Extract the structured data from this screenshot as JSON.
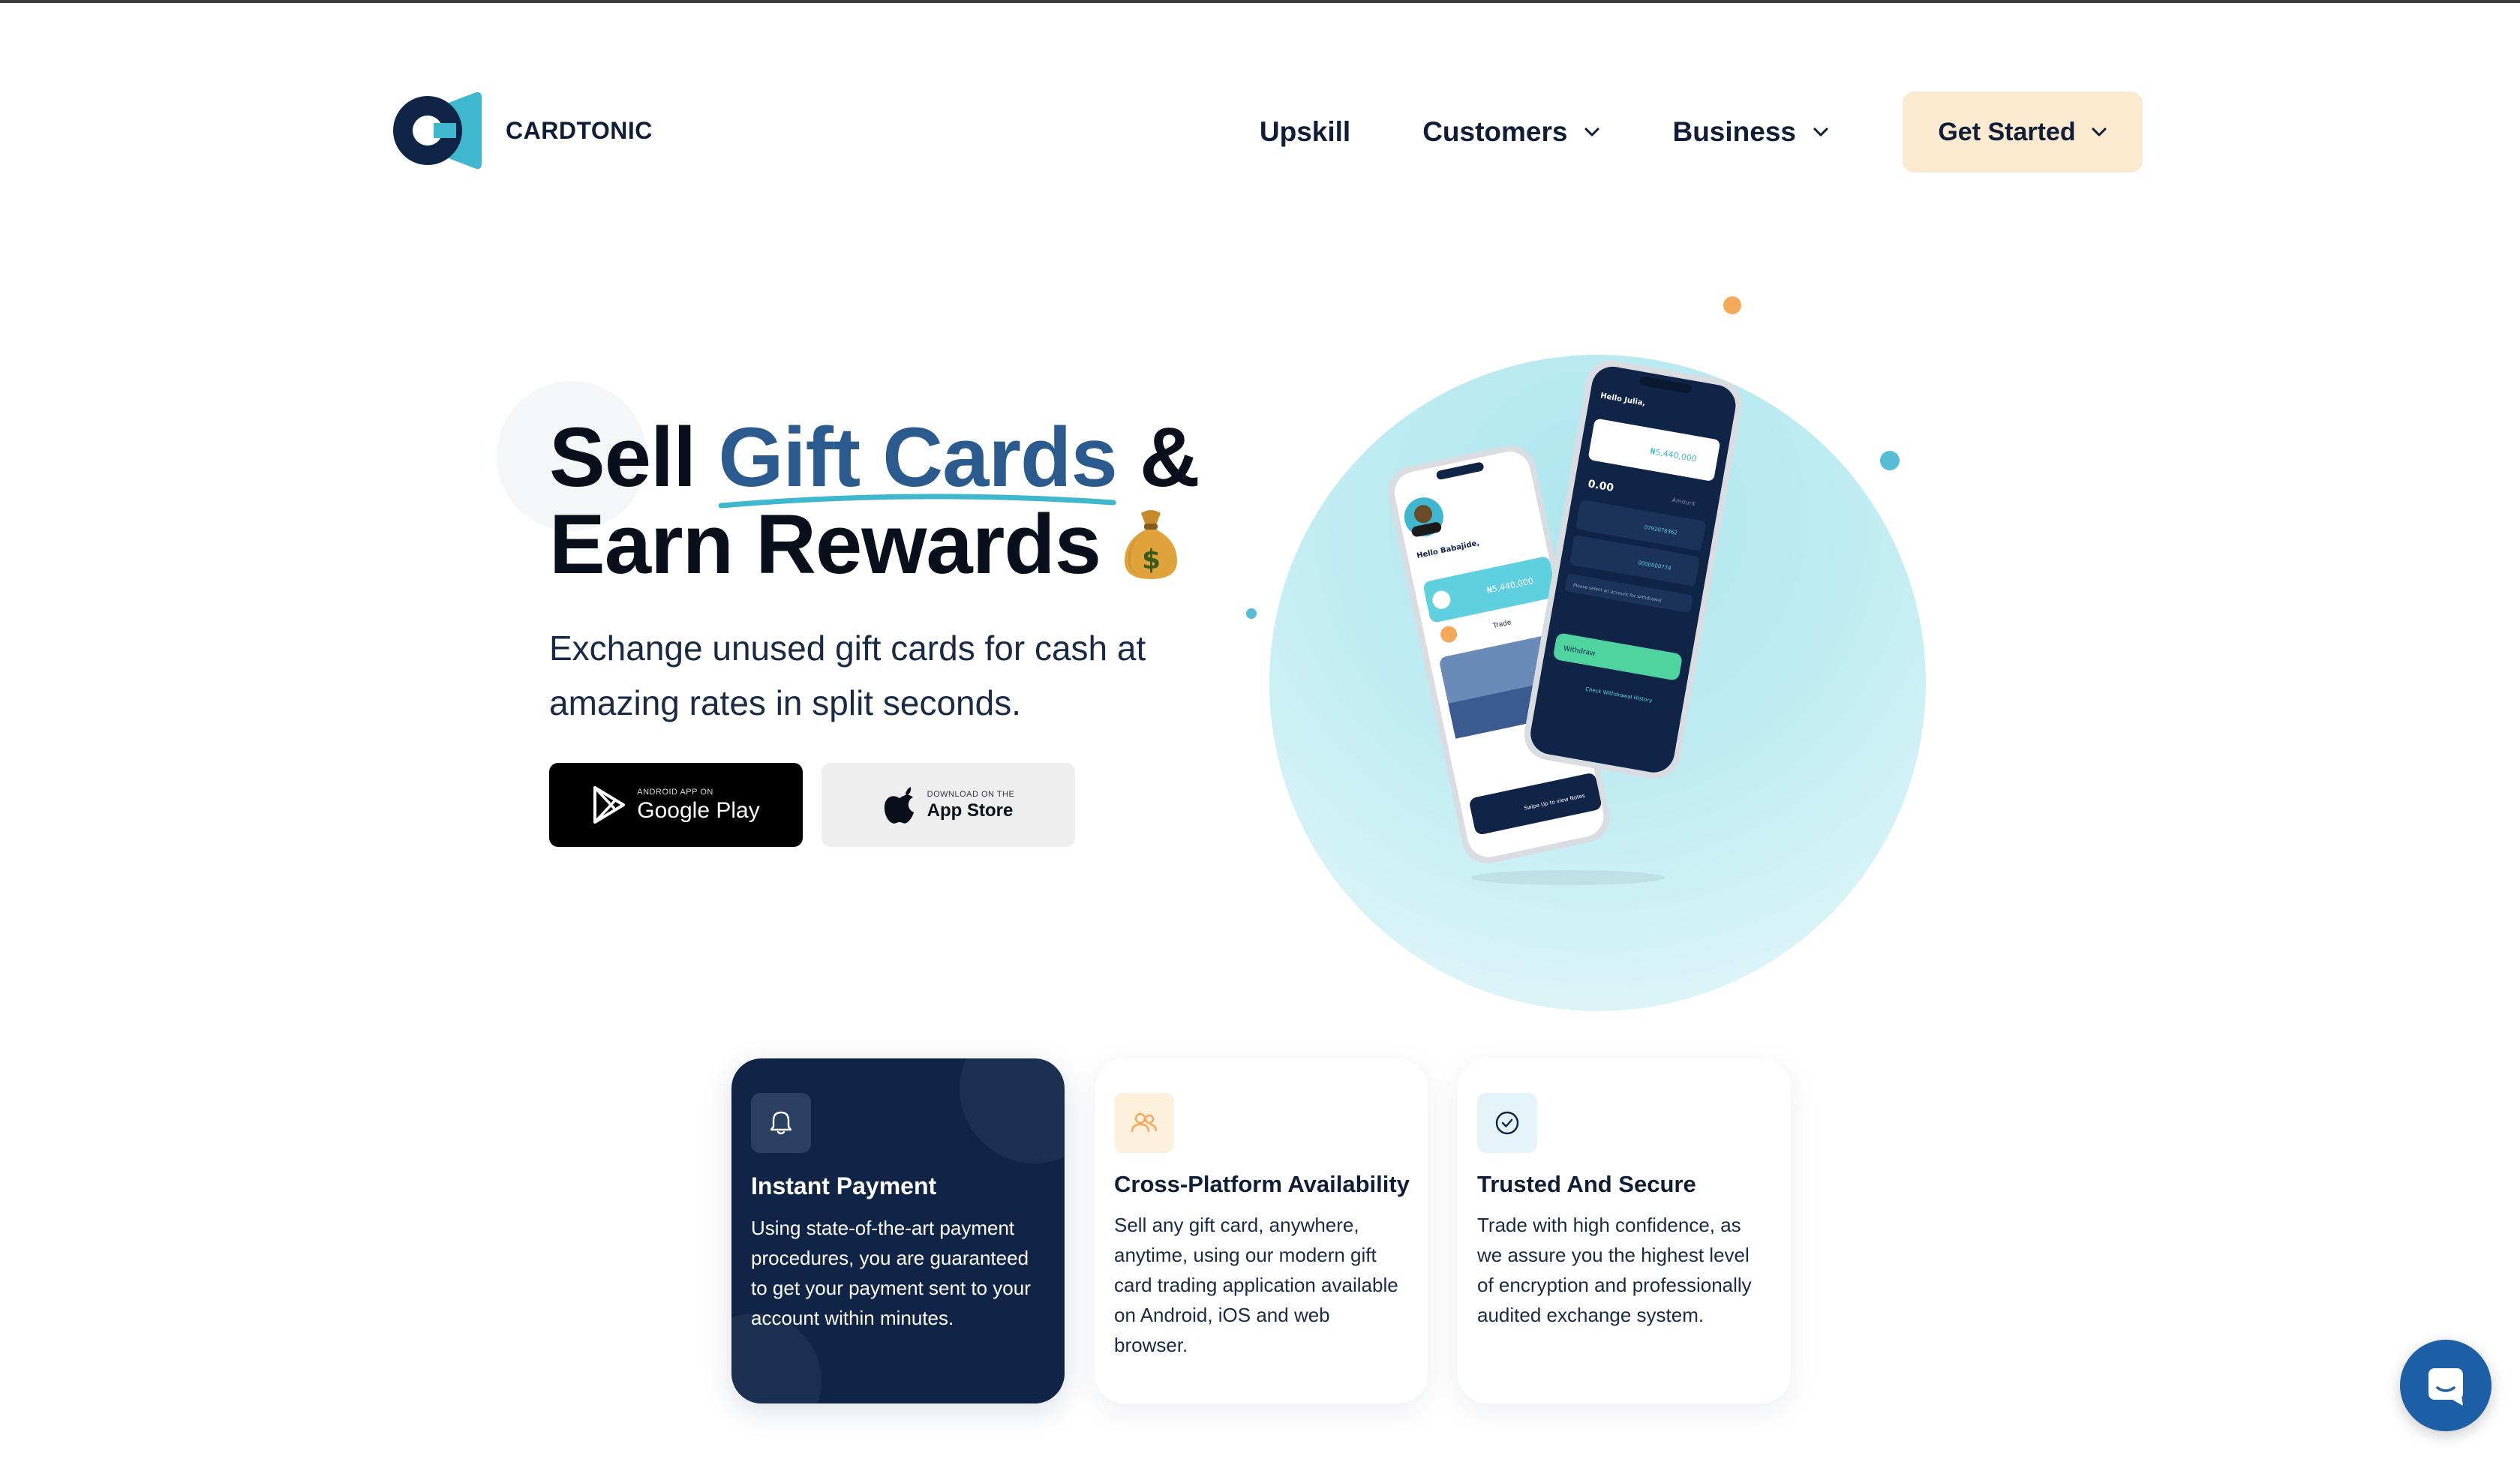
{
  "brand": {
    "name": "CARDTONIC",
    "logo_icon": "cardtonic-logo-icon",
    "colors": {
      "navy": "#0f2447",
      "teal": "#3fb8cf",
      "accent_blue": "#2b5a8f",
      "cta_bg": "#fbead0",
      "orange": "#f4a95c"
    }
  },
  "nav": {
    "items": [
      {
        "label": "Upskill",
        "has_dropdown": false
      },
      {
        "label": "Customers",
        "has_dropdown": true
      },
      {
        "label": "Business",
        "has_dropdown": true
      }
    ],
    "cta": {
      "label": "Get Started",
      "has_dropdown": true
    }
  },
  "hero": {
    "title_prefix": "Sell ",
    "title_highlight": "Gift Cards",
    "title_amp": " &",
    "title_line2": "Earn Rewards",
    "title_emoji_icon": "money-bag-icon",
    "subtitle": "Exchange unused gift cards for cash at amazing rates in split seconds.",
    "google_play": {
      "small": "ANDROID APP ON",
      "big": "Google Play",
      "icon": "google-play-icon"
    },
    "app_store": {
      "small": "DOWNLOAD ON THE",
      "big": "App Store",
      "icon": "apple-icon"
    }
  },
  "phone_mockup": {
    "left_screen": {
      "greeting": "Hello Babajide,",
      "balance": "₦5,440,000",
      "trade_label": "Trade",
      "footer": "Swipe Up to view Notes"
    },
    "right_screen": {
      "greeting": "Hello Julia,",
      "balance": "₦5,440,000",
      "amount": "0.00",
      "amount_label": "Amount",
      "account_1": "0792078362",
      "account_2": "0000000774",
      "withdraw_label": "Withdraw",
      "hint": "Please select an account for withdrawal",
      "footer": "Check Withdrawal History"
    }
  },
  "features": [
    {
      "title": "Instant Payment",
      "text": "Using state-of-the-art payment procedures, you are guaranteed to get your payment sent to your account within minutes.",
      "icon": "bell-icon",
      "theme": "dark"
    },
    {
      "title": "Cross-Platform Availability",
      "text": "Sell any gift card, anywhere, anytime, using our modern gift card trading application available on Android, iOS and web browser.",
      "icon": "users-icon",
      "theme": "light"
    },
    {
      "title": "Trusted And Secure",
      "text": "Trade with high confidence, as we assure you the highest level of encryption and professionally audited exchange system.",
      "icon": "check-circle-icon",
      "theme": "light"
    }
  ],
  "chat_widget": {
    "icon": "chat-icon"
  }
}
